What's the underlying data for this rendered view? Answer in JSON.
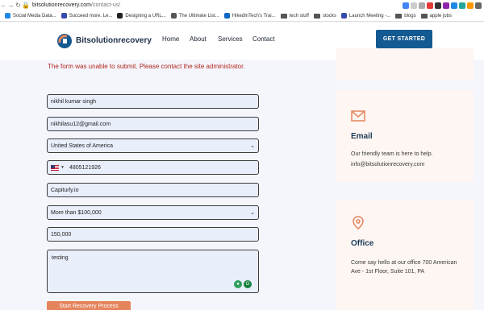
{
  "browser": {
    "url_domain": "bitsolutionrecovery.com",
    "url_path": "/contact-us/"
  },
  "bookmarks": [
    {
      "label": "Social Media Data..."
    },
    {
      "label": "Succeed more. Le..."
    },
    {
      "label": "Designing a URL..."
    },
    {
      "label": "The Ultimate List..."
    },
    {
      "label": "HikedInTech's Trai..."
    },
    {
      "label": "tech stuff"
    },
    {
      "label": "stocks"
    },
    {
      "label": "Launch Meeting -..."
    },
    {
      "label": "blogs"
    },
    {
      "label": "apple jobs"
    }
  ],
  "header": {
    "logo_text": "Bitsolutionrecovery",
    "nav": [
      "Home",
      "About",
      "Services",
      "Contact"
    ],
    "cta_label": "GET STARTED"
  },
  "form": {
    "error_message": "The form was unable to submit. Please contact the site administrator.",
    "name": "nikhil kumar singh",
    "email": "nikhilasu12@gmail.com",
    "country": "United States of America",
    "phone": "4805121926",
    "company": "Capiturly.io",
    "budget_range": "More than $100,000",
    "budget_amount": "150,000",
    "message": "testing",
    "submit_label": "Start Recovery Process"
  },
  "cards": {
    "email": {
      "title": "Email",
      "text": "Our friendly team is here to help.",
      "address": "info@bitsolutionrecovery.com"
    },
    "office": {
      "title": "Office",
      "text": "Come say hello at our office 700 American Ave - 1st Floor, Suite 101, PA"
    }
  },
  "colors": {
    "accent_orange": "#e5845c",
    "brand_blue": "#145a92",
    "error_red": "#b3261e"
  }
}
